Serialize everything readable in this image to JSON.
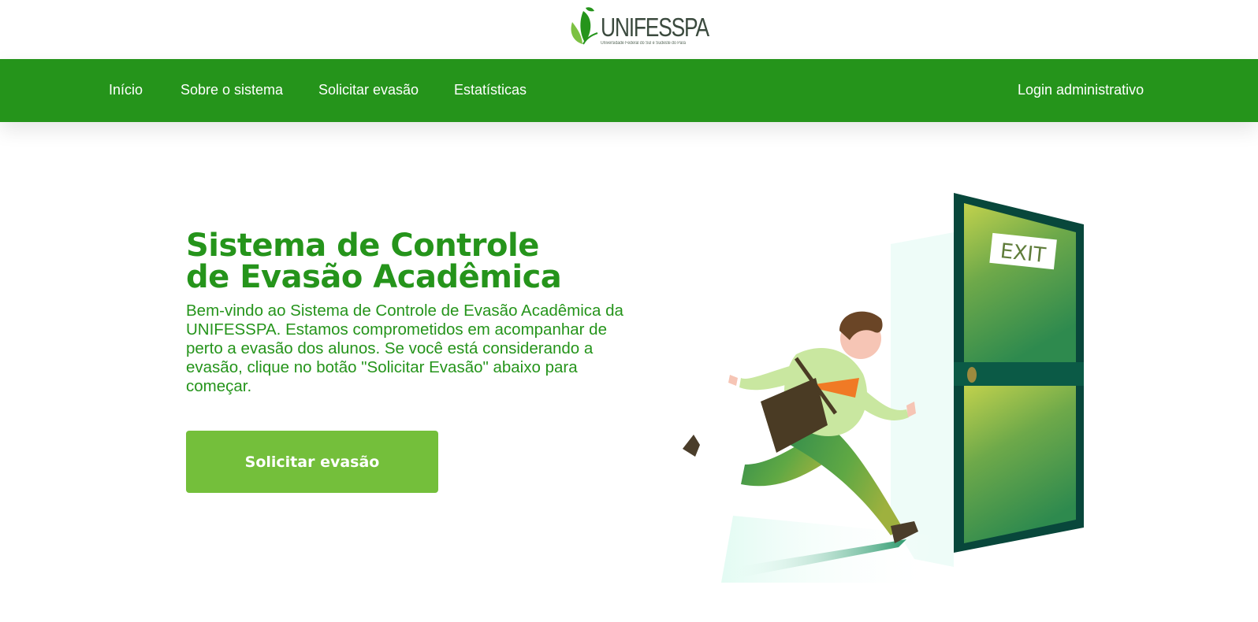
{
  "brand": {
    "name": "UNIFESSPA",
    "subtitle": "Universidade Federal do Sul e Sudeste do Pará",
    "colors": {
      "primary": "#25941b",
      "button": "#74bf3b",
      "text": "#25941b"
    }
  },
  "nav": {
    "items": [
      {
        "label": "Início"
      },
      {
        "label": "Sobre o sistema"
      },
      {
        "label": "Solicitar evasão"
      },
      {
        "label": "Estatísticas"
      }
    ],
    "login_label": "Login administrativo"
  },
  "hero": {
    "title_line1": "Sistema de Controle",
    "title_line2": "de Evasão Acadêmica",
    "description": "Bem-vindo ao Sistema de Controle de Evasão Acadêmica da UNIFESSPA. Estamos comprometidos em acompanhar de perto a evasão dos alunos. Se você está considerando a evasão, clique no botão \"Solicitar Evasão\" abaixo para começar.",
    "button_label": "Solicitar evasão",
    "illustration": {
      "sign_text": "EXIT",
      "icon": "person-running-exit-illustration"
    }
  }
}
